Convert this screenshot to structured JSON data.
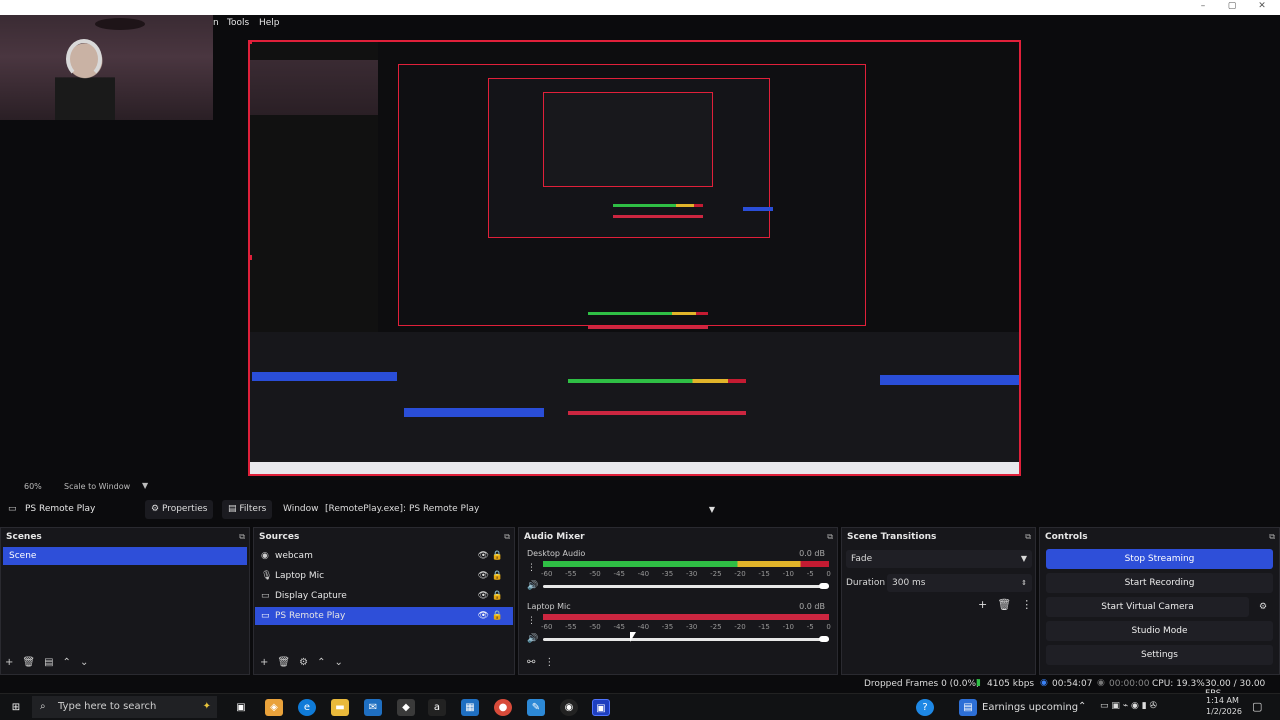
{
  "window": {
    "menu": [
      "n",
      "Tools",
      "Help"
    ],
    "controls": [
      "minimize",
      "maximize",
      "close"
    ]
  },
  "preview": {
    "zoom": "60%",
    "scale_mode": "Scale to Window"
  },
  "source_toolbar": {
    "source_name": "PS Remote Play",
    "properties_label": "Properties",
    "filters_label": "Filters",
    "window_label": "Window",
    "window_value": "[RemotePlay.exe]: PS Remote Play"
  },
  "scenes": {
    "title": "Scenes",
    "items": [
      "Scene"
    ]
  },
  "sources": {
    "title": "Sources",
    "items": [
      {
        "label": "webcam",
        "icon": "camera-icon"
      },
      {
        "label": "Laptop Mic",
        "icon": "mic-icon"
      },
      {
        "label": "Display Capture",
        "icon": "monitor-icon"
      },
      {
        "label": "PS Remote Play",
        "icon": "window-icon"
      }
    ]
  },
  "audio_mixer": {
    "title": "Audio Mixer",
    "channels": [
      {
        "name": "Desktop Audio",
        "db": "0.0 dB",
        "level_green": 0.68,
        "level_yellow": 0.9
      },
      {
        "name": "Laptop Mic",
        "db": "0.0 dB",
        "level_green": 0.0,
        "level_yellow": 0.0
      }
    ],
    "ticks": [
      "-60",
      "-55",
      "-50",
      "-45",
      "-40",
      "-35",
      "-30",
      "-25",
      "-20",
      "-15",
      "-10",
      "-5",
      "0"
    ]
  },
  "scene_transitions": {
    "title": "Scene Transitions",
    "transition": "Fade",
    "duration_label": "Duration",
    "duration_value": "300 ms"
  },
  "controls": {
    "title": "Controls",
    "buttons": [
      "Stop Streaming",
      "Start Recording",
      "Start Virtual Camera",
      "Studio Mode",
      "Settings"
    ]
  },
  "status": {
    "dropped_frames": "Dropped Frames 0 (0.0%)",
    "bitrate": "4105 kbps",
    "stream_time": "00:54:07",
    "record_time": "00:00:00",
    "cpu": "CPU: 19.3%",
    "fps": "30.00 / 30.00 FPS"
  },
  "taskbar": {
    "search_placeholder": "Type here to search",
    "earnings": "Earnings upcoming",
    "time": "1:14 AM",
    "date": "1/2/2026"
  },
  "colors": {
    "accent_blue": "#2e4fd9",
    "record_red": "#e0203a",
    "meter_green": "#2fbf45",
    "meter_yellow": "#e1b42a",
    "meter_red": "#c41b32",
    "mic_red": "#cc2640"
  }
}
